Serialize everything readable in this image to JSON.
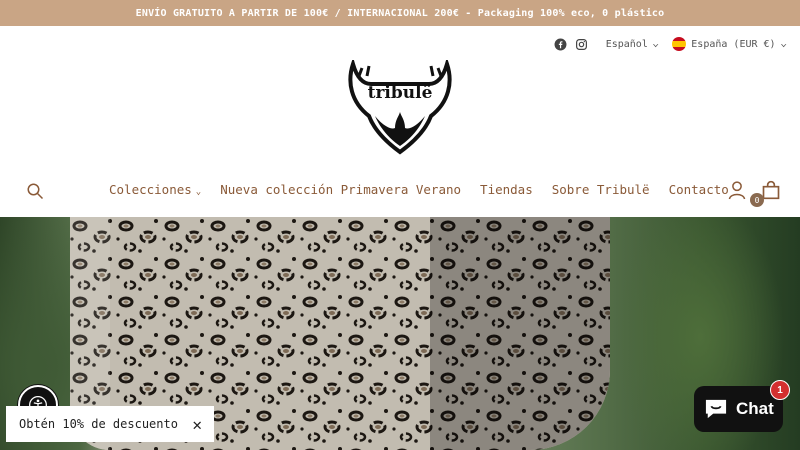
{
  "announcement": "ENVÍO GRATUITO A PARTIR DE 100€ / INTERNACIONAL 200€ - Packaging 100% eco, 0 plástico",
  "topbar": {
    "language": "Español",
    "currency": "España (EUR €)"
  },
  "logo": {
    "text": "tribulë"
  },
  "nav": {
    "items": [
      {
        "label": "Colecciones"
      },
      {
        "label": "Nueva colección Primavera Verano"
      },
      {
        "label": "Tiendas"
      },
      {
        "label": "Sobre Tribulë"
      },
      {
        "label": "Contacto"
      }
    ],
    "cart_count": "0"
  },
  "discount": {
    "label": "Obtén 10% de descuento"
  },
  "chat": {
    "label": "Chat",
    "badge": "1"
  },
  "colors": {
    "announcement_bg": "#c9a585",
    "nav_text": "#8a5a38"
  }
}
